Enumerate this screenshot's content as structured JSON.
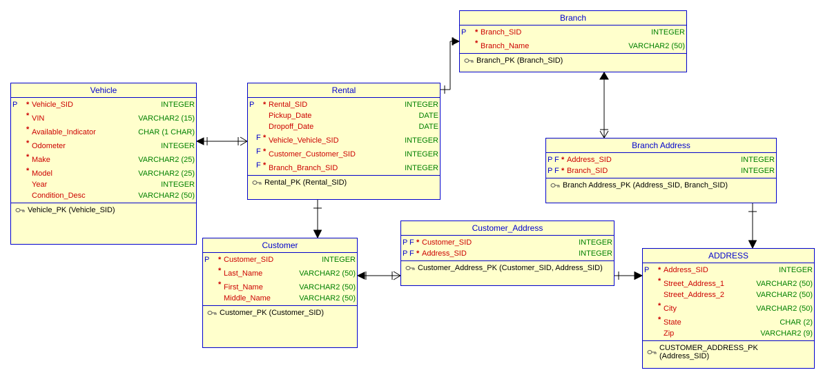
{
  "entities": {
    "vehicle": {
      "name": "Vehicle",
      "cols": [
        {
          "p": "P",
          "f": "",
          "star": "*",
          "name": "Vehicle_SID",
          "type": "INTEGER"
        },
        {
          "p": "",
          "f": "",
          "star": "*",
          "name": "VIN",
          "type": "VARCHAR2 (15)"
        },
        {
          "p": "",
          "f": "",
          "star": "*",
          "name": "Available_Indicator",
          "type": "CHAR (1 CHAR)"
        },
        {
          "p": "",
          "f": "",
          "star": "*",
          "name": "Odometer",
          "type": "INTEGER"
        },
        {
          "p": "",
          "f": "",
          "star": "*",
          "name": "Make",
          "type": "VARCHAR2 (25)"
        },
        {
          "p": "",
          "f": "",
          "star": "*",
          "name": "Model",
          "type": "VARCHAR2 (25)"
        },
        {
          "p": "",
          "f": "",
          "star": "",
          "name": "Year",
          "type": "INTEGER"
        },
        {
          "p": "",
          "f": "",
          "star": "",
          "name": "Condition_Desc",
          "type": "VARCHAR2 (50)"
        }
      ],
      "key": "Vehicle_PK (Vehicle_SID)"
    },
    "rental": {
      "name": "Rental",
      "cols": [
        {
          "p": "P",
          "f": "",
          "star": "*",
          "name": "Rental_SID",
          "type": "INTEGER"
        },
        {
          "p": "",
          "f": "",
          "star": "",
          "name": "Pickup_Date",
          "type": "DATE"
        },
        {
          "p": "",
          "f": "",
          "star": "",
          "name": "Dropoff_Date",
          "type": "DATE"
        },
        {
          "p": "",
          "f": "F",
          "star": "*",
          "name": "Vehicle_Vehicle_SID",
          "type": "INTEGER"
        },
        {
          "p": "",
          "f": "F",
          "star": "*",
          "name": "Customer_Customer_SID",
          "type": "INTEGER"
        },
        {
          "p": "",
          "f": "F",
          "star": "*",
          "name": "Branch_Branch_SID",
          "type": "INTEGER"
        }
      ],
      "key": "Rental_PK (Rental_SID)"
    },
    "branch": {
      "name": "Branch",
      "cols": [
        {
          "p": "P",
          "f": "",
          "star": "*",
          "name": "Branch_SID",
          "type": "INTEGER"
        },
        {
          "p": "",
          "f": "",
          "star": "*",
          "name": "Branch_Name",
          "type": "VARCHAR2 (50)"
        }
      ],
      "key": "Branch_PK (Branch_SID)"
    },
    "branch_address": {
      "name": "Branch Address",
      "cols": [
        {
          "p": "P",
          "f": "F",
          "star": "*",
          "name": "Address_SID",
          "type": "INTEGER"
        },
        {
          "p": "P",
          "f": "F",
          "star": "*",
          "name": "Branch_SID",
          "type": "INTEGER"
        }
      ],
      "key": "Branch Address_PK (Address_SID, Branch_SID)"
    },
    "customer_address": {
      "name": "Customer_Address",
      "cols": [
        {
          "p": "P",
          "f": "F",
          "star": "*",
          "name": "Customer_SID",
          "type": "INTEGER"
        },
        {
          "p": "P",
          "f": "F",
          "star": "*",
          "name": "Address_SID",
          "type": "INTEGER"
        }
      ],
      "key": "Customer_Address_PK (Customer_SID, Address_SID)"
    },
    "customer": {
      "name": "Customer",
      "cols": [
        {
          "p": "P",
          "f": "",
          "star": "*",
          "name": "Customer_SID",
          "type": "INTEGER"
        },
        {
          "p": "",
          "f": "",
          "star": "*",
          "name": "Last_Name",
          "type": "VARCHAR2 (50)"
        },
        {
          "p": "",
          "f": "",
          "star": "*",
          "name": "First_Name",
          "type": "VARCHAR2 (50)"
        },
        {
          "p": "",
          "f": "",
          "star": "",
          "name": "Middle_Name",
          "type": "VARCHAR2 (50)"
        }
      ],
      "key": "Customer_PK (Customer_SID)"
    },
    "address": {
      "name": "ADDRESS",
      "cols": [
        {
          "p": "P",
          "f": "",
          "star": "*",
          "name": "Address_SID",
          "type": "INTEGER"
        },
        {
          "p": "",
          "f": "",
          "star": "*",
          "name": "Street_Address_1",
          "type": "VARCHAR2 (50)"
        },
        {
          "p": "",
          "f": "",
          "star": "",
          "name": "Street_Address_2",
          "type": "VARCHAR2 (50)"
        },
        {
          "p": "",
          "f": "",
          "star": "*",
          "name": "City",
          "type": "VARCHAR2 (50)"
        },
        {
          "p": "",
          "f": "",
          "star": "*",
          "name": "State",
          "type": "CHAR (2)"
        },
        {
          "p": "",
          "f": "",
          "star": "",
          "name": "Zip",
          "type": "VARCHAR2 (9)"
        }
      ],
      "key": "CUSTOMER_ADDRESS_PK (Address_SID)"
    }
  },
  "relationships": [
    {
      "from": "Rental",
      "to": "Vehicle",
      "from_card": "many",
      "to_card": "one"
    },
    {
      "from": "Rental",
      "to": "Branch",
      "from_card": "many",
      "to_card": "one"
    },
    {
      "from": "Rental",
      "to": "Customer",
      "from_card": "many",
      "to_card": "one"
    },
    {
      "from": "Branch Address",
      "to": "Branch",
      "from_card": "many",
      "to_card": "one"
    },
    {
      "from": "Branch Address",
      "to": "ADDRESS",
      "from_card": "many",
      "to_card": "one"
    },
    {
      "from": "Customer_Address",
      "to": "Customer",
      "from_card": "many",
      "to_card": "one"
    },
    {
      "from": "Customer_Address",
      "to": "ADDRESS",
      "from_card": "many",
      "to_card": "one"
    }
  ],
  "colors": {
    "entity_bg": "#ffffcc",
    "entity_border": "#0000cc",
    "title_text": "#0000cc",
    "column_name": "#cc0000",
    "column_type": "#008000",
    "pk_flag": "#0000cc",
    "required_star": "#cc0000"
  }
}
